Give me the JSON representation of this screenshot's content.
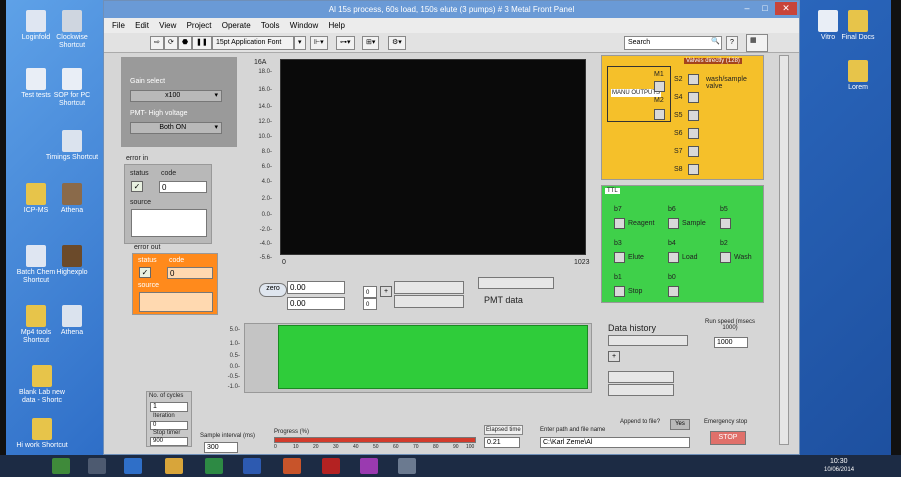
{
  "window": {
    "title": "Al 15s process, 60s load, 150s elute (3 pumps) # 3 Metal Front Panel"
  },
  "menu": [
    "File",
    "Edit",
    "View",
    "Project",
    "Operate",
    "Tools",
    "Window",
    "Help"
  ],
  "toolbar": {
    "font": "15pt Application Font",
    "search_placeholder": "Search"
  },
  "desktop_icons": [
    {
      "label": "Loginfold"
    },
    {
      "label": "Clockwise Shortcut"
    },
    {
      "label": "Test tests"
    },
    {
      "label": "SOP for PC Shortcut"
    },
    {
      "label": "Timings Shortcut"
    },
    {
      "label": "ICP-MS"
    },
    {
      "label": "Athena"
    },
    {
      "label": "Batch Chem Shortcut"
    },
    {
      "label": "Highexplo"
    },
    {
      "label": "Mp4 tools Shortcut"
    },
    {
      "label": "Athena"
    },
    {
      "label": "Blank Lab new data - Shortc"
    },
    {
      "label": "Hi work Shortcut"
    },
    {
      "label": "Vitro"
    },
    {
      "label": "Final Docs"
    },
    {
      "label": "Lorem"
    }
  ],
  "controls": {
    "gain_label": "Gain select",
    "gain_value": "x100",
    "pmt_label": "PMT- High voltage",
    "pmt_value": "Both ON",
    "error_in": {
      "title": "error in",
      "status": "status",
      "code": "code",
      "code_val": "0",
      "source": "source"
    },
    "error_out": {
      "title": "error out",
      "status": "status",
      "code": "code",
      "code_val": "0",
      "source": "source"
    }
  },
  "chart_main": {
    "ylabel": "16A",
    "ticks": [
      "18.0-",
      "16.0-",
      "14.0-",
      "12.0-",
      "10.0-",
      "8.0-",
      "6.0-",
      "4.0-",
      "2.0-",
      "0.0-",
      "-2.0-",
      "-4.0-",
      "-5.6-"
    ],
    "x_start": "0",
    "x_end": "1023"
  },
  "pmt": {
    "btn": "zero",
    "val1": "0.00",
    "val2": "0.00",
    "label": "PMT data",
    "idx1": "0",
    "idx2": "0"
  },
  "valves": {
    "title": "Valves directly (128)",
    "manual_label": "MANU OUTPUTS",
    "m1": "M1",
    "m2": "M2",
    "items": [
      "S2",
      "S4",
      "S5",
      "S6",
      "S7",
      "S8"
    ],
    "wash_label": "wash/sample valve"
  },
  "ttl": {
    "title": "TTL",
    "items": [
      {
        "num": "b7",
        "label": "Reagent"
      },
      {
        "num": "b6",
        "label": "Sample"
      },
      {
        "num": "b5",
        "label": ""
      },
      {
        "num": "b3",
        "label": "Elute"
      },
      {
        "num": "b4",
        "label": "Load"
      },
      {
        "num": "b2",
        "label": "Wash"
      },
      {
        "num": "b1",
        "label": "Stop"
      },
      {
        "num": "b0",
        "label": ""
      }
    ]
  },
  "history": {
    "title": "Data history",
    "run_speed": "Run speed (msecs 1000)",
    "run_speed_val": "1000"
  },
  "chart_small": {
    "ticks": [
      "5.0-",
      "1.0-",
      "0.5-",
      "0.0-",
      "-0.5-",
      "-1.0-"
    ]
  },
  "cycles": {
    "title": "No. of cycles",
    "val1": "1",
    "iter_label": "Iteration",
    "val2": "0",
    "stop_label": "Stop timer",
    "val3": "900"
  },
  "sample": {
    "label": "Sample interval (ms)",
    "val": "300"
  },
  "progress": {
    "label": "Progress (%)",
    "ticks": [
      "0",
      "10",
      "20",
      "30",
      "40",
      "50",
      "60",
      "70",
      "80",
      "90",
      "100"
    ],
    "value": 1.0
  },
  "elapsed": {
    "label": "Elapsed time",
    "val": "0.21"
  },
  "path": {
    "label": "Enter path and file name",
    "val": "C:\\Karl Zeme\\Al",
    "append": "Append to file?",
    "yes": "Yes"
  },
  "emergency": {
    "label": "Emergency stop",
    "btn": "STOP"
  },
  "taskbar": {
    "time": "10:30",
    "date": "10/06/2014"
  },
  "colors": {
    "valves": "#f5c02a",
    "ttl": "#3fd04a",
    "chart_small": "#2fcc3a",
    "error_out": "#ff8a1c",
    "progress": "#d23b2c"
  }
}
